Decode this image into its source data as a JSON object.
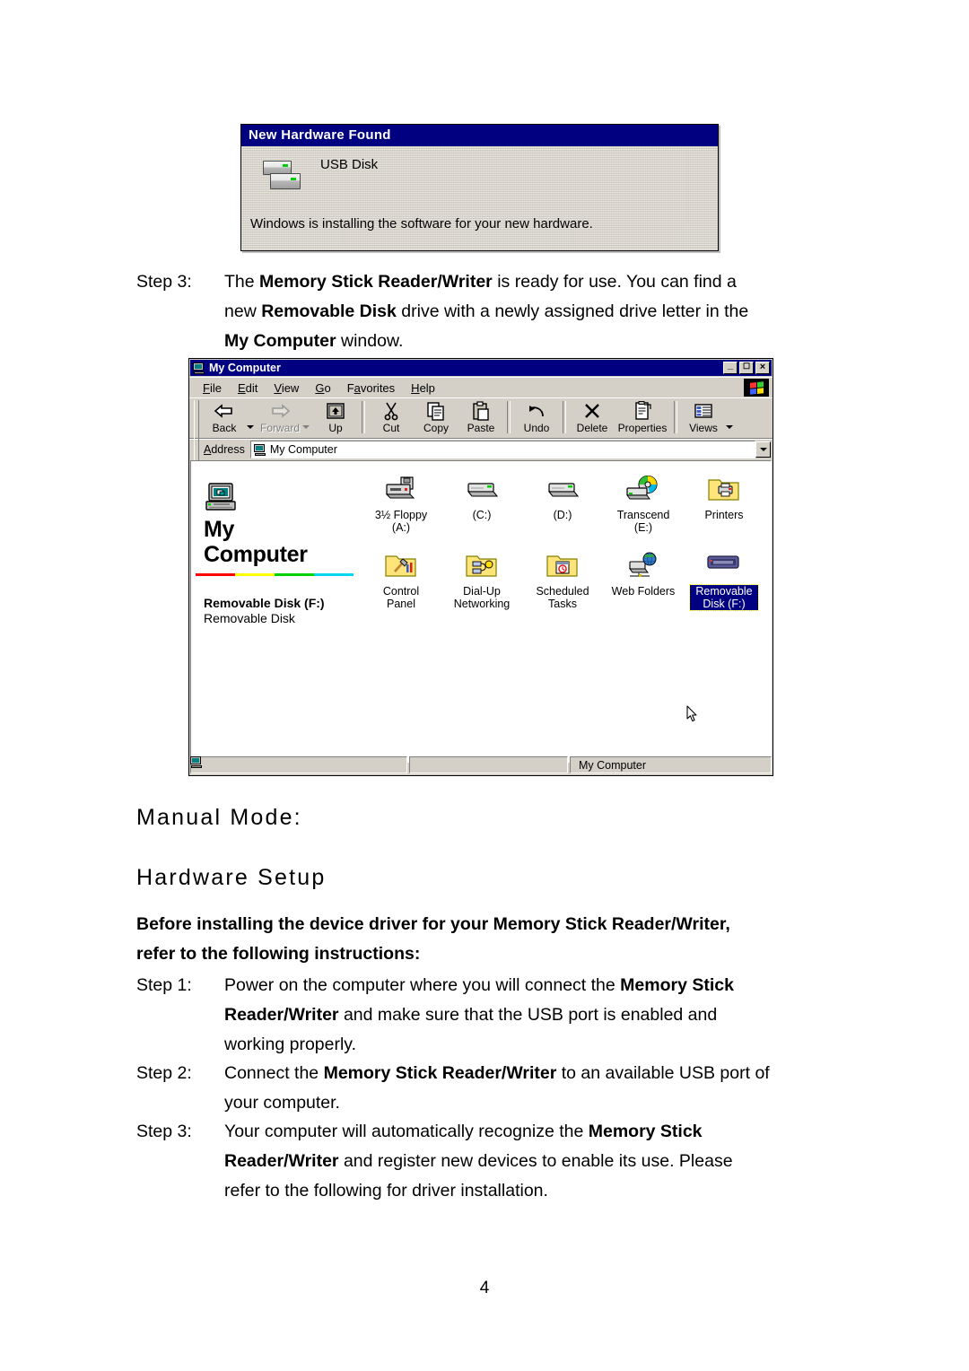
{
  "new_hardware_dialog": {
    "title": "New Hardware Found",
    "device_name": "USB Disk",
    "message": "Windows is installing the software for your new hardware.",
    "icon": "usb-disk-stack-icon",
    "title_bar_color": "#000080",
    "face_color": "#d4d0c8"
  },
  "step3_top": {
    "label": "Step 3:",
    "line1_a": "The ",
    "line1_b": "Memory Stick Reader/Writer",
    "line1_c": " is ready for use. You can find a",
    "line2_a": "new ",
    "line2_b": "Removable Disk",
    "line2_c": " drive with a newly assigned drive letter in the",
    "line3_b": "My Computer",
    "line3_c": " window."
  },
  "explorer": {
    "title": "My Computer",
    "title_icon": "my-computer-icon",
    "window_buttons": {
      "minimize": "_",
      "restore": "❐",
      "close": "×"
    },
    "menu": [
      {
        "label": "File",
        "accel": "F"
      },
      {
        "label": "Edit",
        "accel": "E"
      },
      {
        "label": "View",
        "accel": "V"
      },
      {
        "label": "Go",
        "accel": "G"
      },
      {
        "label": "Favorites",
        "accel": "a"
      },
      {
        "label": "Help",
        "accel": "H"
      }
    ],
    "toolbar": [
      {
        "label": "Back",
        "icon": "back-arrow-icon",
        "disabled": false,
        "has_dropdown": true
      },
      {
        "label": "Forward",
        "icon": "forward-arrow-icon",
        "disabled": true,
        "has_dropdown": true
      },
      {
        "label": "Up",
        "icon": "up-folder-icon",
        "disabled": false,
        "has_dropdown": false
      },
      {
        "label": "Cut",
        "icon": "scissors-icon",
        "disabled": false,
        "has_dropdown": false
      },
      {
        "label": "Copy",
        "icon": "copy-pages-icon",
        "disabled": false,
        "has_dropdown": false
      },
      {
        "label": "Paste",
        "icon": "clipboard-paste-icon",
        "disabled": false,
        "has_dropdown": false
      },
      {
        "label": "Undo",
        "icon": "undo-arrow-icon",
        "disabled": false,
        "has_dropdown": false
      },
      {
        "label": "Delete",
        "icon": "delete-x-icon",
        "disabled": false,
        "has_dropdown": false
      },
      {
        "label": "Properties",
        "icon": "properties-sheet-icon",
        "disabled": false,
        "has_dropdown": false
      },
      {
        "label": "Views",
        "icon": "views-list-icon",
        "disabled": false,
        "has_dropdown": true
      }
    ],
    "address": {
      "label": "Address",
      "value": "My Computer",
      "icon": "my-computer-icon",
      "dropdown_icon": "chevron-down-icon"
    },
    "web_pane": {
      "heading_line1": "My",
      "heading_line2": "Computer",
      "icon": "my-computer-large-icon",
      "rule_colors": [
        "#ff0000",
        "#ffff00",
        "#00d000",
        "#00d8f0"
      ],
      "selected_name": "Removable Disk (F:)",
      "selected_type": "Removable Disk"
    },
    "items": [
      {
        "label": "3½ Floppy (A:)",
        "icon": "floppy-drive-icon",
        "selected": false
      },
      {
        "label": "(C:)",
        "icon": "hard-drive-icon",
        "selected": false
      },
      {
        "label": "(D:)",
        "icon": "hard-drive-icon",
        "selected": false
      },
      {
        "label": "Transcend (E:)",
        "icon": "cd-drive-icon",
        "selected": false
      },
      {
        "label": "Printers",
        "icon": "printers-folder-icon",
        "selected": false
      },
      {
        "label": "Control Panel",
        "icon": "control-panel-folder-icon",
        "selected": false
      },
      {
        "label": "Dial-Up Networking",
        "icon": "dialup-networking-folder-icon",
        "selected": false
      },
      {
        "label": "Scheduled Tasks",
        "icon": "scheduled-tasks-folder-icon",
        "selected": false
      },
      {
        "label": "Web Folders",
        "icon": "web-folders-icon",
        "selected": false
      },
      {
        "label": "Removable Disk (F:)",
        "icon": "removable-disk-icon",
        "selected": true
      }
    ],
    "statusbar": {
      "pane1": "",
      "pane2": "",
      "pane3": "My Computer",
      "pane3_icon": "my-computer-icon"
    }
  },
  "headings": {
    "manual_mode": "Manual Mode:",
    "hardware_setup": "Hardware Setup"
  },
  "intro_bold": {
    "line1": "Before installing the device driver for your Memory Stick Reader/Writer,",
    "line2": "refer to the following instructions:"
  },
  "steps": [
    {
      "label": "Step 1:",
      "l1a": "Power on the computer where you will connect the ",
      "l1b": "Memory Stick",
      "l2b": "Reader/Writer",
      "l2c": " and make sure that the USB port is enabled and",
      "l3": "working properly."
    },
    {
      "label": "Step 2:",
      "l1a": "Connect the ",
      "l1b": "Memory Stick Reader/Writer",
      "l1c": " to an available USB port of",
      "l2": "your computer."
    },
    {
      "label": "Step 3:",
      "l1a": "Your computer will automatically recognize the ",
      "l1b": "Memory Stick",
      "l2b": "Reader/Writer",
      "l2c": " and register new devices to enable its use.  Please",
      "l3": "refer to the following for driver installation."
    }
  ],
  "page_number": "4"
}
